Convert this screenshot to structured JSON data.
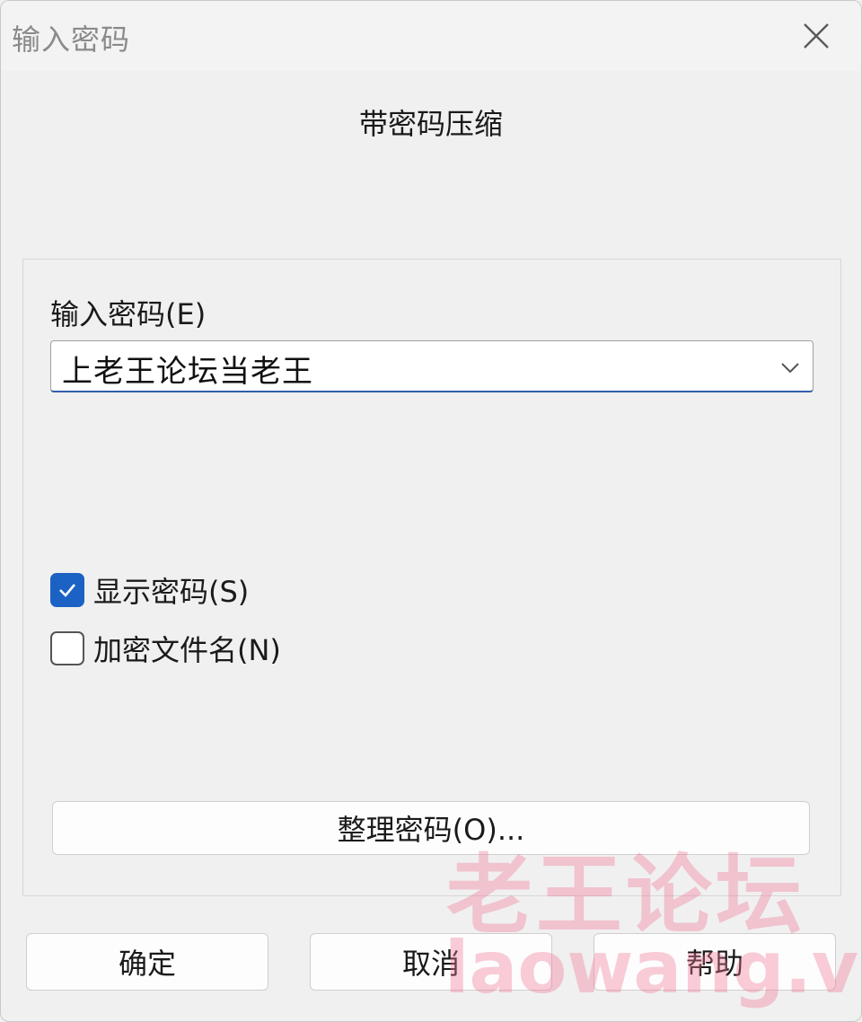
{
  "window": {
    "title": "输入密码",
    "close_icon": "close-icon"
  },
  "heading": "带密码压缩",
  "password_field": {
    "label": "输入密码(E)",
    "value": "上老王论坛当老王",
    "arrow_icon": "chevron-down-icon"
  },
  "options": {
    "show_password": {
      "label": "显示密码(S)",
      "checked": true
    },
    "encrypt_filenames": {
      "label": "加密文件名(N)",
      "checked": false
    }
  },
  "organize_button": "整理密码(O)...",
  "buttons": {
    "ok": "确定",
    "cancel": "取消",
    "help": "帮助"
  },
  "watermark": {
    "line1": "老王论坛",
    "line2": "laowang.vip"
  },
  "colors": {
    "accent": "#1c61c4",
    "watermark": "#f07896"
  }
}
